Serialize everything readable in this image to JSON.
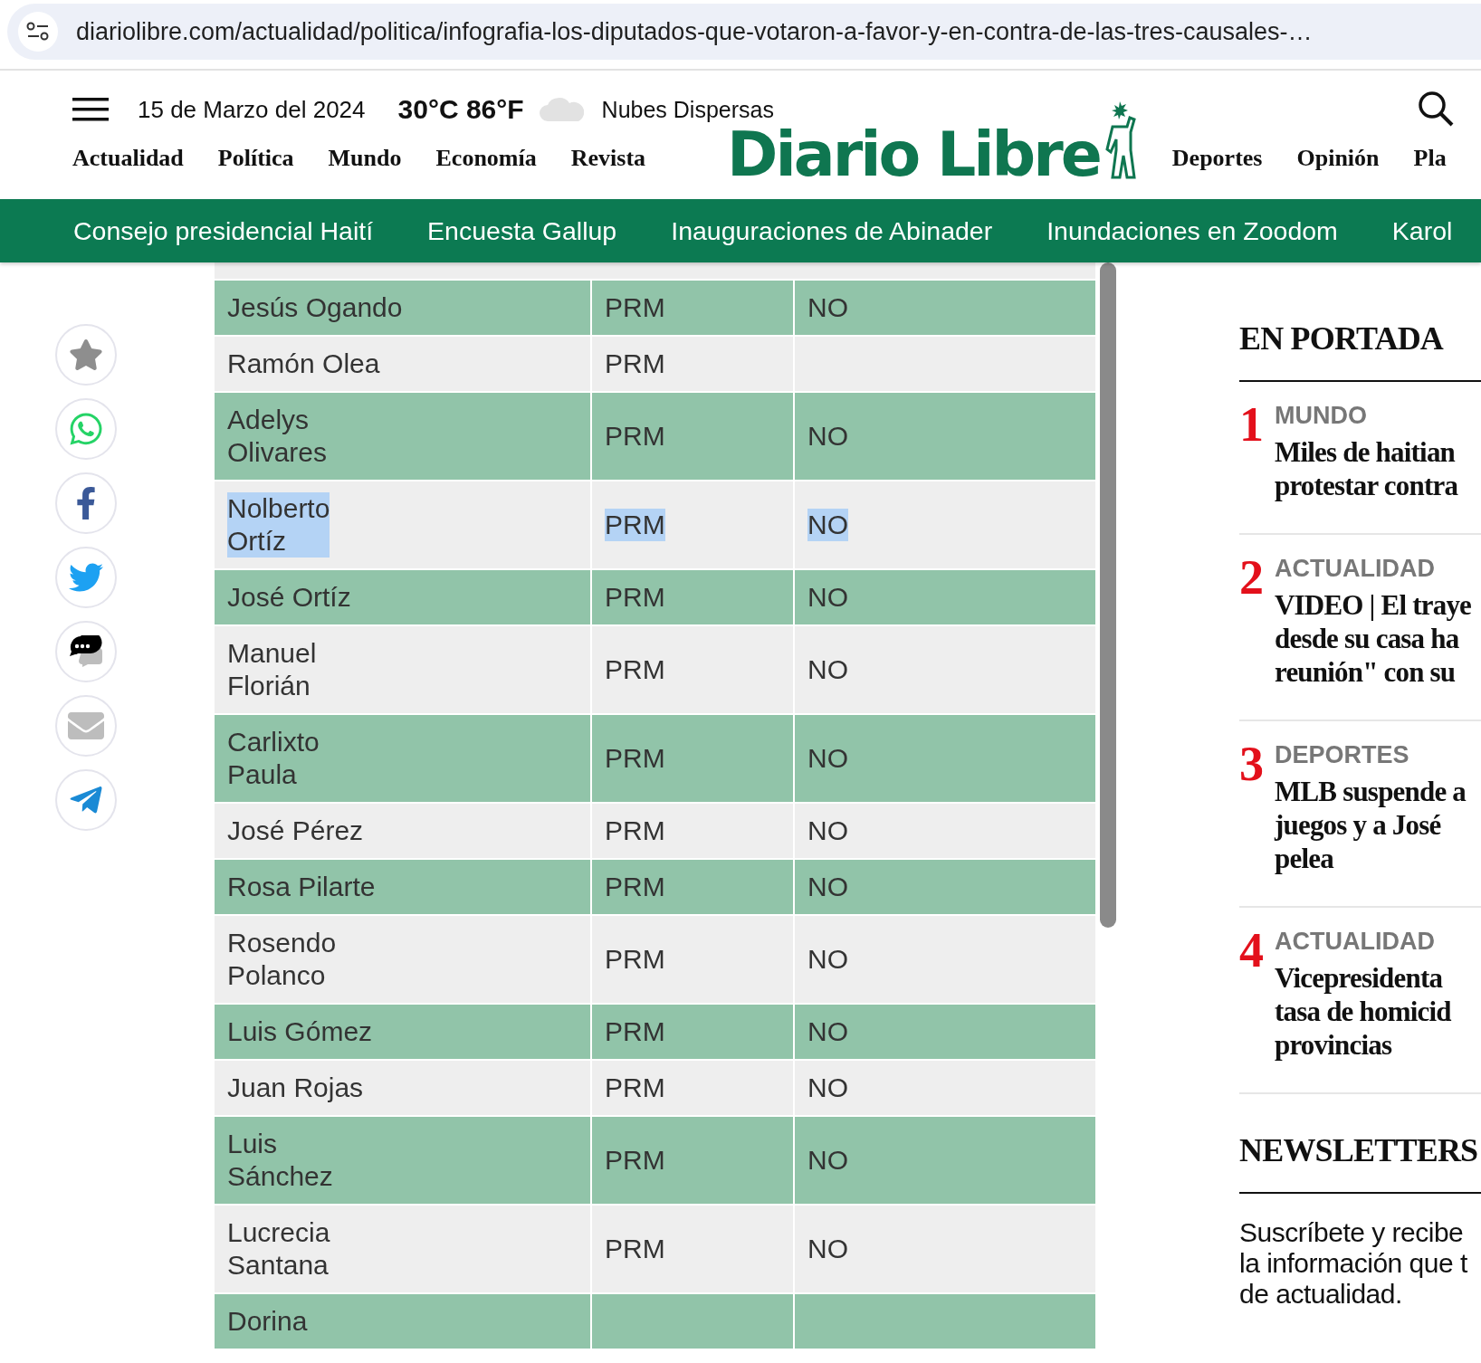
{
  "browser": {
    "url": "diariolibre.com/actualidad/politica/infografia-los-diputados-que-votaron-a-favor-y-en-contra-de-las-tres-causales-…"
  },
  "header": {
    "date": "15 de Marzo del 2024",
    "temperature": "30°C 86°F",
    "weather": "Nubes Dispersas",
    "logo": "Diario Libre",
    "nav_left": [
      "Actualidad",
      "Política",
      "Mundo",
      "Economía",
      "Revista"
    ],
    "nav_right": [
      "Deportes",
      "Opinión",
      "Pla"
    ]
  },
  "trending": [
    "Consejo presidencial Haití",
    "Encuesta Gallup",
    "Inauguraciones de Abinader",
    "Inundaciones en Zoodom",
    "Karol"
  ],
  "share_buttons": [
    {
      "kind": "star"
    },
    {
      "kind": "whatsapp"
    },
    {
      "kind": "facebook"
    },
    {
      "kind": "twitter"
    },
    {
      "kind": "messages"
    },
    {
      "kind": "email"
    },
    {
      "kind": "telegram"
    }
  ],
  "table": {
    "rows": [
      {
        "name": "Jesús Ogando",
        "party": "PRM",
        "vote": "NO",
        "text_selected": false
      },
      {
        "name": "Ramón Olea",
        "party": "PRM",
        "text_selected": false
      },
      {
        "name": "Adelys\nOlivares",
        "party": "PRM",
        "vote": "NO",
        "text_selected": false
      },
      {
        "name": "Nolberto\nOrtíz",
        "party": "PRM",
        "vote": "NO",
        "text_selected": true
      },
      {
        "name": "José Ortíz",
        "party": "PRM",
        "vote": "NO",
        "text_selected": false
      },
      {
        "name": "Manuel\nFlorián",
        "party": "PRM",
        "vote": "NO",
        "text_selected": false
      },
      {
        "name": "Carlixto\nPaula",
        "party": "PRM",
        "vote": "NO",
        "text_selected": false
      },
      {
        "name": "José Pérez",
        "party": "PRM",
        "vote": "NO",
        "text_selected": false
      },
      {
        "name": "Rosa Pilarte",
        "party": "PRM",
        "vote": "NO",
        "text_selected": false
      },
      {
        "name": "Rosendo\nPolanco",
        "party": "PRM",
        "vote": "NO",
        "text_selected": false
      },
      {
        "name": "Luis Gómez",
        "party": "PRM",
        "vote": "NO",
        "text_selected": false
      },
      {
        "name": "Juan Rojas",
        "party": "PRM",
        "vote": "NO",
        "text_selected": false
      },
      {
        "name": "Luis\nSánchez",
        "party": "PRM",
        "vote": "NO",
        "text_selected": false
      },
      {
        "name": "Lucrecia\nSantana",
        "party": "PRM",
        "vote": "NO",
        "text_selected": false
      },
      {
        "name": "Dorina",
        "text_selected": false
      }
    ]
  },
  "sidebar": {
    "title": "EN PORTADA",
    "stories": [
      {
        "rank": "1",
        "category": "MUNDO",
        "headline": "Miles de haitian\nprotestar contra"
      },
      {
        "rank": "2",
        "category": "ACTUALIDAD",
        "headline": "VIDEO | El traye\ndesde su casa ha\nreunión\" con su"
      },
      {
        "rank": "3",
        "category": "DEPORTES",
        "headline": "MLB suspende a\njuegos y a José\npelea"
      },
      {
        "rank": "4",
        "category": "ACTUALIDAD",
        "headline": "Vicepresidenta\ntasa de homicid\nprovincias"
      }
    ],
    "newsletter": {
      "title": "NEWSLETTERS",
      "text": "Suscríbete y recibe\nla información que t\nde actualidad."
    }
  }
}
